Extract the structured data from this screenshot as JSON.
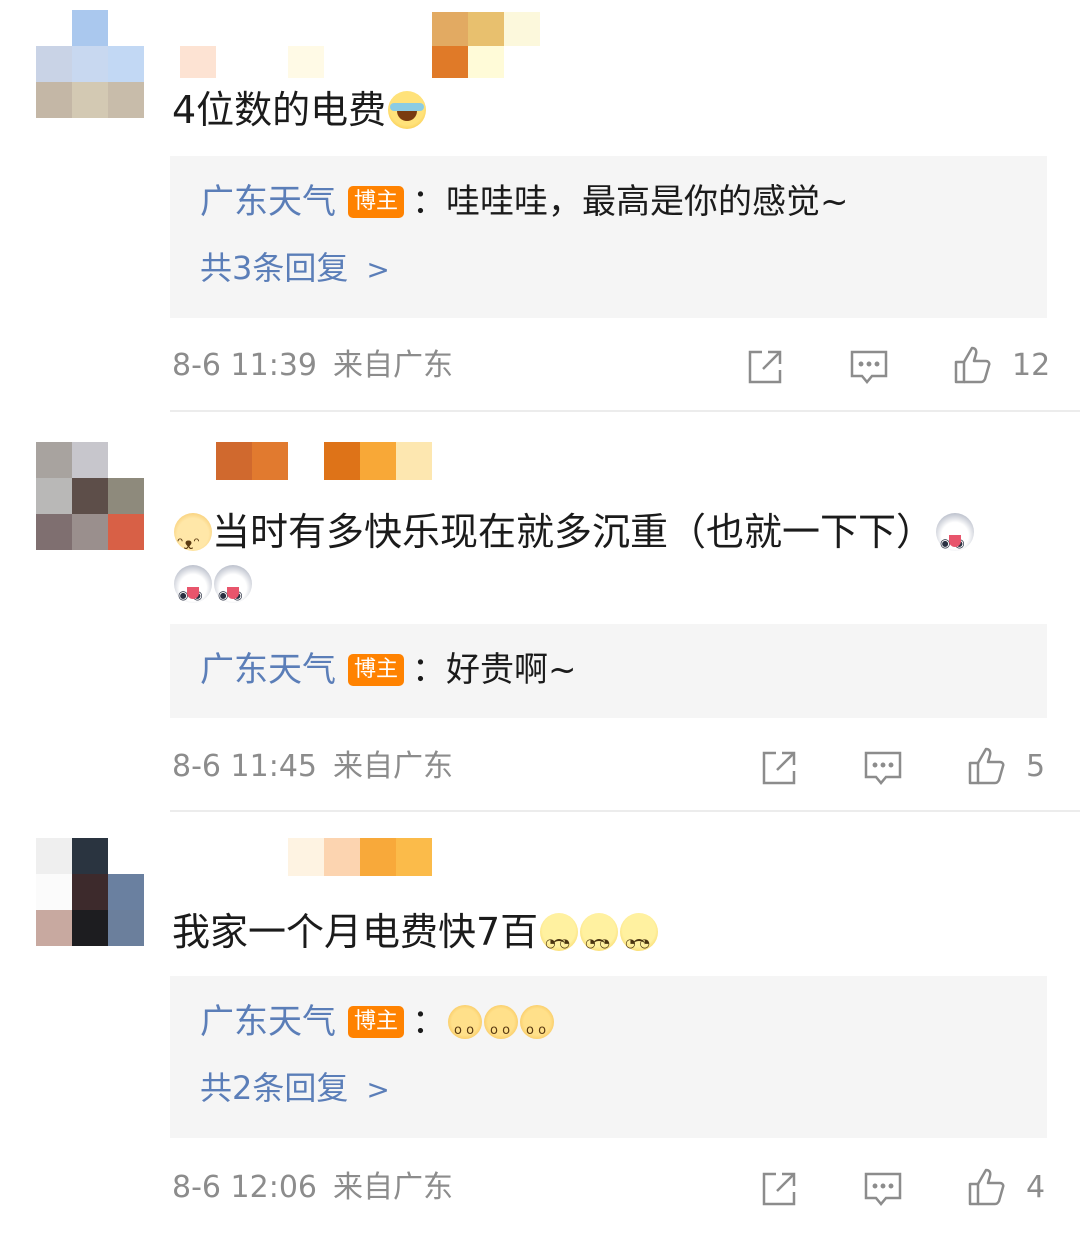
{
  "comments": [
    {
      "text": "4位数的电费",
      "reply": {
        "author": "广东天气",
        "badge": "博主",
        "text": "：哇哇哇，最高是你的感觉~"
      },
      "more_replies": "共3条回复",
      "time": "8-6 11:39",
      "source": "来自广东",
      "likes": "12"
    },
    {
      "text_line1": "当时有多快乐现在就多沉重（也就一下下）",
      "reply": {
        "author": "广东天气",
        "badge": "博主",
        "text": "：好贵啊~"
      },
      "time": "8-6 11:45",
      "source": "来自广东",
      "likes": "5"
    },
    {
      "text": "我家一个月电费快7百",
      "reply": {
        "author": "广东天气",
        "badge": "博主",
        "text": "："
      },
      "more_replies": "共2条回复",
      "time": "8-6 12:06",
      "source": "来自广东",
      "likes": "4"
    }
  ],
  "icons": {
    "share": "share-icon",
    "comment": "comment-icon",
    "like": "thumbs-up-icon",
    "more": "chevron-right-icon"
  },
  "colors": {
    "link": "#5b7eb8",
    "badge": "#ff8200",
    "reply_bg": "#f5f5f5",
    "meta": "#8c8c8c"
  }
}
